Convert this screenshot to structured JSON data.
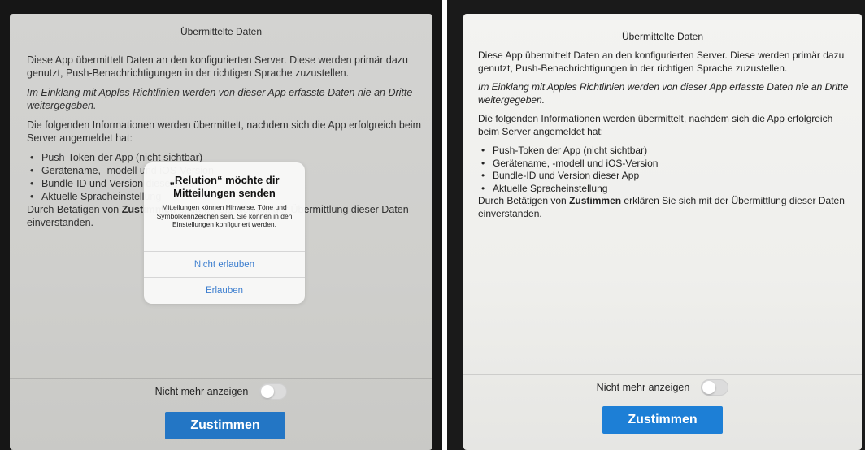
{
  "screen_title": "Übermittelte Daten",
  "intro": "Diese App übermittelt Daten an den konfigurierten Server. Diese werden primär dazu genutzt, Push-Benachrichtigungen in der richtigen Sprache zuzustellen.",
  "policy_note": "Im Einklang mit Apples Richtlinien werden von dieser App erfasste Daten nie an Dritte weitergegeben.",
  "info_heading": "Die folgenden Informationen werden übermittelt, nachdem sich die App erfolgreich beim Server angemeldet hat:",
  "items": [
    "Push-Token der App (nicht sichtbar)",
    "Gerätename, -modell und iOS-Version",
    "Bundle-ID und Version dieser App",
    "Aktuelle Spracheinstellung"
  ],
  "closing_before": "Durch Betätigen von ",
  "closing_bold": "Zustimmen",
  "closing_after": " erklären Sie sich mit der Übermittlung dieser Daten einverstanden.",
  "toggle_label": "Nicht mehr anzeigen",
  "toggle_on": false,
  "primary_button": "Zustimmen",
  "alert": {
    "title": "„Relution“ möchte dir Mitteilungen senden",
    "message": "Mitteilungen können Hinweise, Töne und Symbolkennzeichen sein. Sie können in den Einstellungen konfiguriert werden.",
    "deny_button": "Nicht erlauben",
    "allow_button": "Erlauben"
  },
  "colors": {
    "accent": "#1d7fd6",
    "alert_link": "#3e7fcf"
  }
}
